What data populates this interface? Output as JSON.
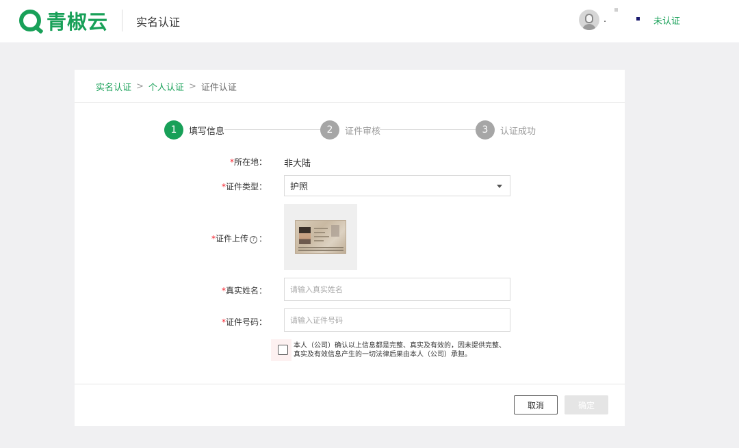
{
  "header": {
    "logo_text": "青椒云",
    "page_title": "实名认证",
    "user_name": ".",
    "verify_status": "未认证"
  },
  "breadcrumb": {
    "items": [
      "实名认证",
      "个人认证",
      "证件认证"
    ],
    "separator": ">"
  },
  "steps": [
    {
      "number": "1",
      "label": "填写信息",
      "active": true
    },
    {
      "number": "2",
      "label": "证件审核",
      "active": false
    },
    {
      "number": "3",
      "label": "认证成功",
      "active": false
    }
  ],
  "form": {
    "required_mark": "*",
    "location": {
      "label": "所在地：",
      "value": "非大陆"
    },
    "id_type": {
      "label": "证件类型：",
      "value": "护照"
    },
    "upload": {
      "label_before": "证件上传",
      "label_after": "：",
      "help_symbol": "?"
    },
    "real_name": {
      "label": "真实姓名：",
      "placeholder": "请输入真实姓名",
      "value": ""
    },
    "id_number": {
      "label": "证件号码：",
      "placeholder": "请输入证件号码",
      "value": ""
    },
    "agreement": {
      "line1": "本人（公司）确认以上信息都是完整、真实及有效的，因未提供完整、",
      "line2": "真实及有效信息产生的一切法律后果由本人（公司）承担。",
      "checked": false
    }
  },
  "buttons": {
    "cancel": "取消",
    "confirm": "确定"
  },
  "colors": {
    "brand": "#18a058",
    "required": "#f5222d",
    "inactive_step": "#a6a6a6"
  }
}
